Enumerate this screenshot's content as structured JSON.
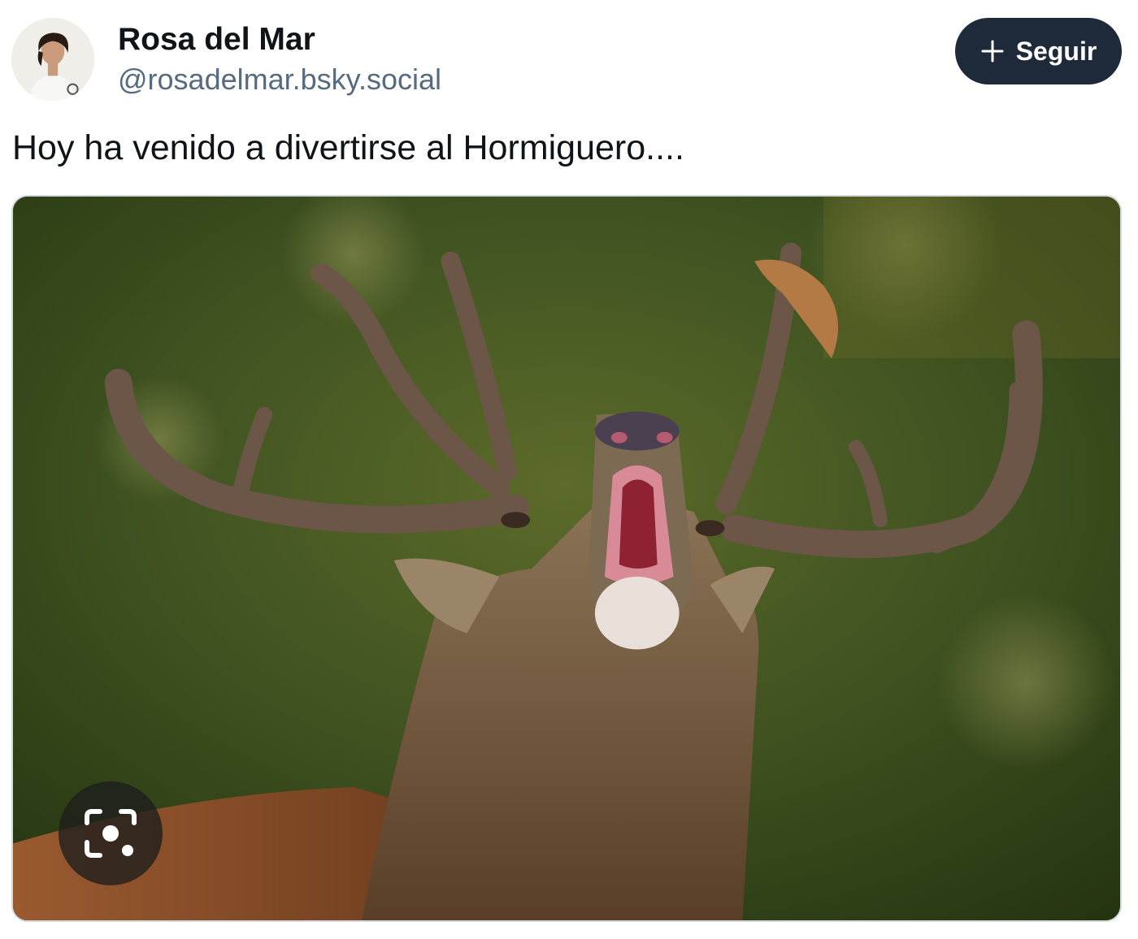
{
  "author": {
    "display_name": "Rosa del Mar",
    "handle": "@rosadelmar.bsky.social",
    "avatar_icon": "profile-photo"
  },
  "follow_button": {
    "label": "Seguir",
    "icon": "plus-icon",
    "background": "#1e2a3a"
  },
  "post": {
    "text": "Hoy ha venido a divertirse al Hormiguero....",
    "image_subject": "red deer stag bellowing with large antlers",
    "image_overlay_icon": "visual-search-icon"
  },
  "colors": {
    "name": "#0f1419",
    "handle": "#566b7f",
    "button_bg": "#1e2a3a"
  }
}
